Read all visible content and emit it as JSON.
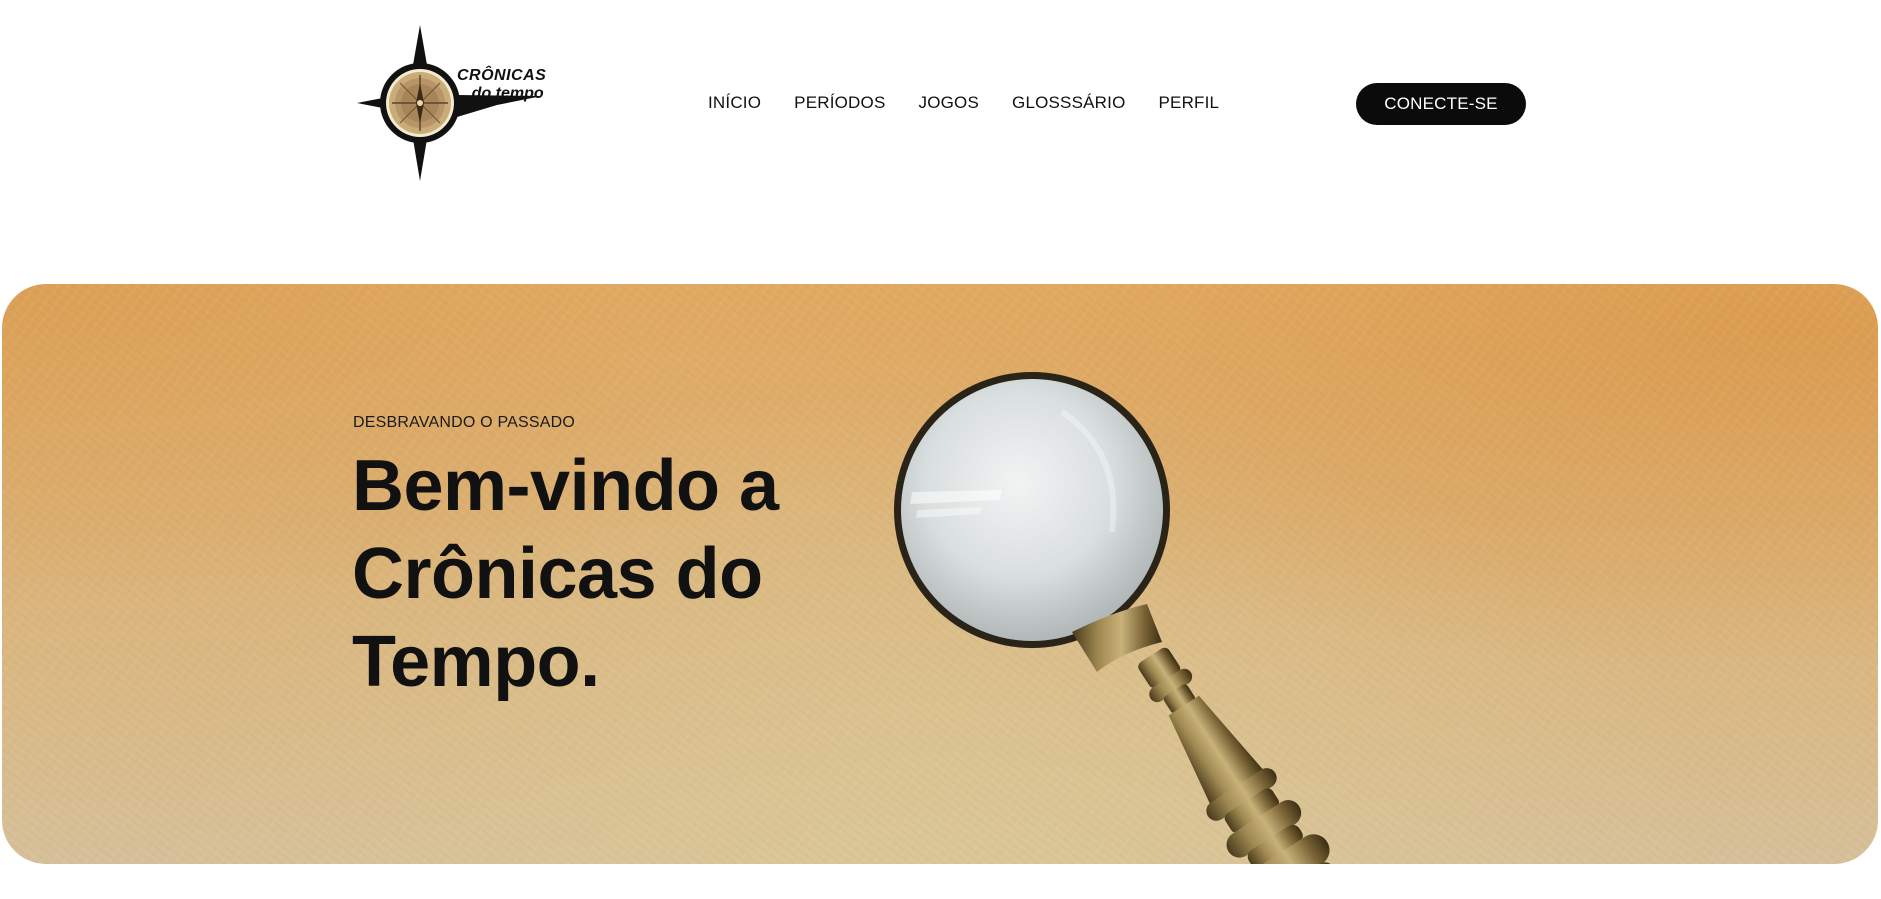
{
  "header": {
    "logo": {
      "line1": "CRÔNICAS",
      "line2": "do tempo",
      "icon": "compass-rose-icon"
    },
    "nav": [
      {
        "label": "INÍCIO"
      },
      {
        "label": "PERÍODOS"
      },
      {
        "label": "JOGOS"
      },
      {
        "label": "GLOSSSÁRIO"
      },
      {
        "label": "PERFIL"
      }
    ],
    "cta_label": "CONECTE-SE"
  },
  "hero": {
    "eyebrow": "DESBRAVANDO O PASSADO",
    "title": "Bem-vindo a Crônicas do Tempo.",
    "image": "magnifying-glass-icon"
  },
  "colors": {
    "cta_background": "#0b0b0b",
    "hero_background": "#e0b272",
    "text": "#111111"
  }
}
